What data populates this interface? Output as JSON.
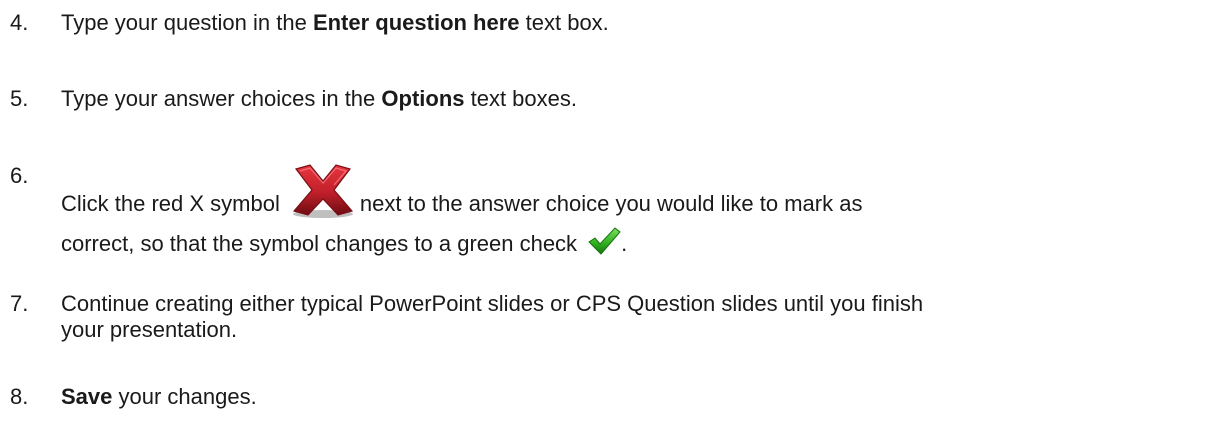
{
  "steps": [
    {
      "number": "4.",
      "prefix": "Type your question in the ",
      "bold": "Enter question here",
      "suffix": " text box."
    },
    {
      "number": "5.",
      "prefix": "Type your answer choices in the ",
      "bold": "Options",
      "suffix": " text boxes."
    },
    {
      "number": "6.",
      "prefix": "Click the red X symbol",
      "after_icon": "next to the answer choice you would like to mark as",
      "line2": "correct, so that the symbol changes to a green check",
      "end": ".",
      "icons": [
        "red-x-icon",
        "green-check-icon"
      ]
    },
    {
      "number": "7.",
      "line1": "Continue creating either typical PowerPoint slides or CPS Question slides until you finish",
      "line2": "your presentation."
    },
    {
      "number": "8.",
      "bold": "Save",
      "suffix": " your changes."
    }
  ],
  "colors": {
    "red_x": "#c0202a",
    "green_check": "#2fae1f"
  }
}
